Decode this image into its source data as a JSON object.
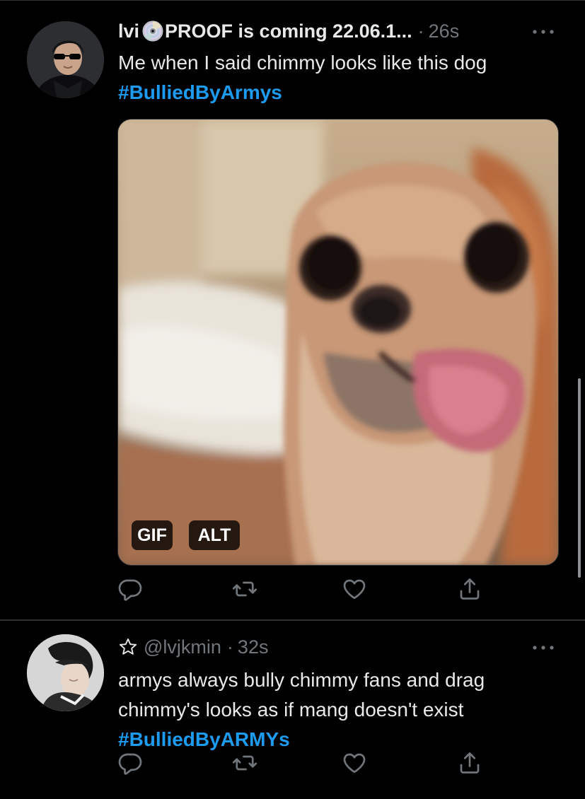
{
  "tweets": [
    {
      "display_name": "lvi",
      "name_suffix": "PROOF is coming 22.06.1...",
      "separator": "·",
      "time": "26s",
      "text": "Me when I said chimmy looks like this dog",
      "hashtag": "#BulliedByArmys",
      "media": {
        "gif_badge": "GIF",
        "alt_badge": "ALT"
      }
    },
    {
      "handle": "@lvjkmin",
      "separator": "·",
      "time": "32s",
      "text": "armys always bully chimmy fans and drag chimmy's looks as if mang doesn't exist",
      "hashtag": "#BulliedByARMYs"
    }
  ],
  "icons": {
    "reply": "reply-icon",
    "retweet": "retweet-icon",
    "like": "like-icon",
    "share": "share-icon",
    "more": "more-icon",
    "disc": "disc-emoji-icon",
    "star": "star-icon"
  },
  "colors": {
    "background": "#000000",
    "text": "#e7e9ea",
    "muted": "#71767b",
    "link": "#1d9bf0",
    "divider": "#2f3336"
  }
}
